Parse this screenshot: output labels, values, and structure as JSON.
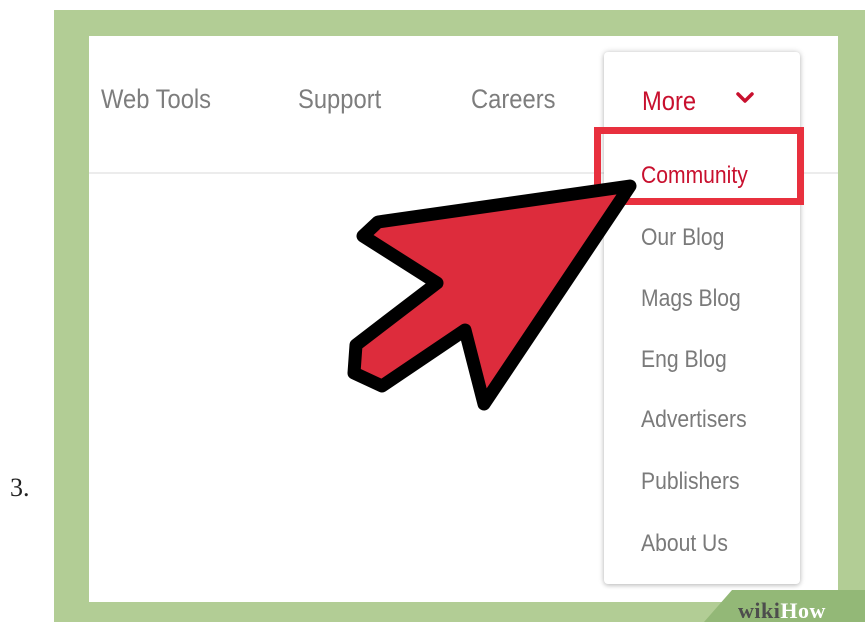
{
  "step": {
    "number": "3."
  },
  "nav": {
    "items": [
      "Web Tools",
      "Support",
      "Careers"
    ],
    "more_label": "More"
  },
  "dropdown": {
    "items": [
      "Community",
      "Our Blog",
      "Mags Blog",
      "Eng Blog",
      "Advertisers",
      "Publishers",
      "About Us"
    ],
    "active_index": 0
  },
  "watermark": {
    "wiki": "wiki",
    "how": "How"
  },
  "colors": {
    "frame_green": "#b2cd95",
    "accent_red": "#c8102e",
    "arrow_fill": "#dd2c3c",
    "highlight_border": "#e8303e",
    "nav_text": "#7d7d7d"
  }
}
